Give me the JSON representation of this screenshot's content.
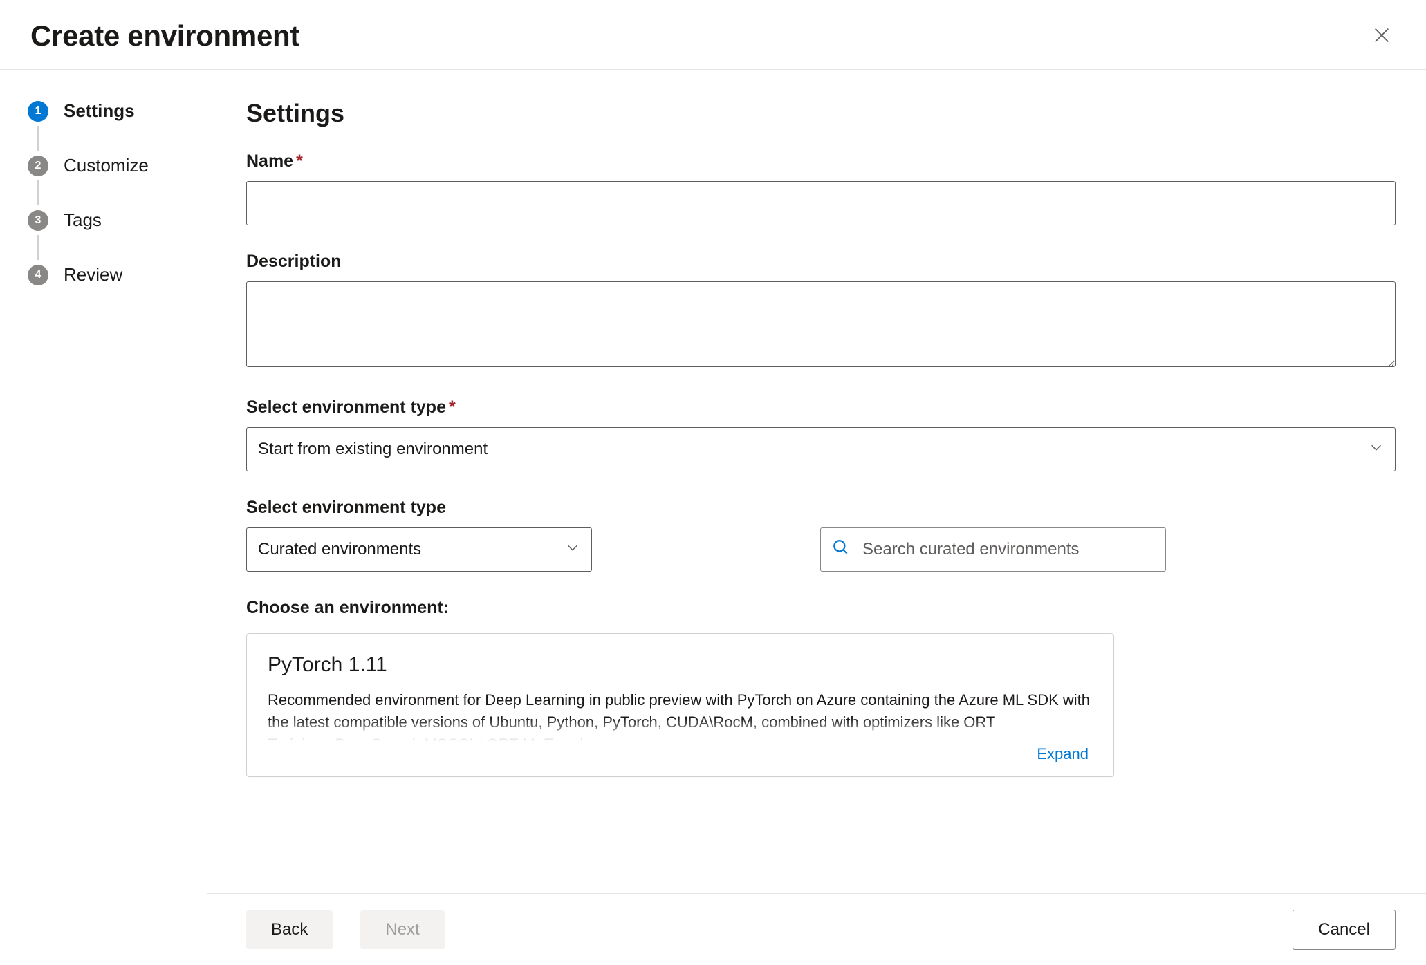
{
  "header": {
    "title": "Create environment"
  },
  "stepper": {
    "steps": [
      {
        "num": "1",
        "label": "Settings"
      },
      {
        "num": "2",
        "label": "Customize"
      },
      {
        "num": "3",
        "label": "Tags"
      },
      {
        "num": "4",
        "label": "Review"
      }
    ],
    "active_index": 0
  },
  "main": {
    "heading": "Settings",
    "name_label": "Name",
    "name_value": "",
    "description_label": "Description",
    "description_value": "",
    "env_type_label": "Select environment type",
    "env_type_value": "Start from existing environment",
    "env_subtype_label": "Select environment type",
    "env_subtype_value": "Curated environments",
    "search_placeholder": "Search curated environments",
    "choose_label": "Choose an environment:",
    "card": {
      "title": "PyTorch 1.11",
      "description": "Recommended environment for Deep Learning in public preview with PyTorch on Azure containing the Azure ML SDK with the latest compatible versions of Ubuntu, Python, PyTorch, CUDA\\RocM, combined with optimizers like ORT Training,+DeepSpeed+MSCCL+ORT MoE and more.",
      "expand_label": "Expand"
    }
  },
  "footer": {
    "back_label": "Back",
    "next_label": "Next",
    "cancel_label": "Cancel"
  },
  "colors": {
    "primary": "#0078d4",
    "text": "#1b1a19",
    "muted": "#605e5c",
    "border": "#d2d0ce",
    "required": "#a4262c"
  }
}
